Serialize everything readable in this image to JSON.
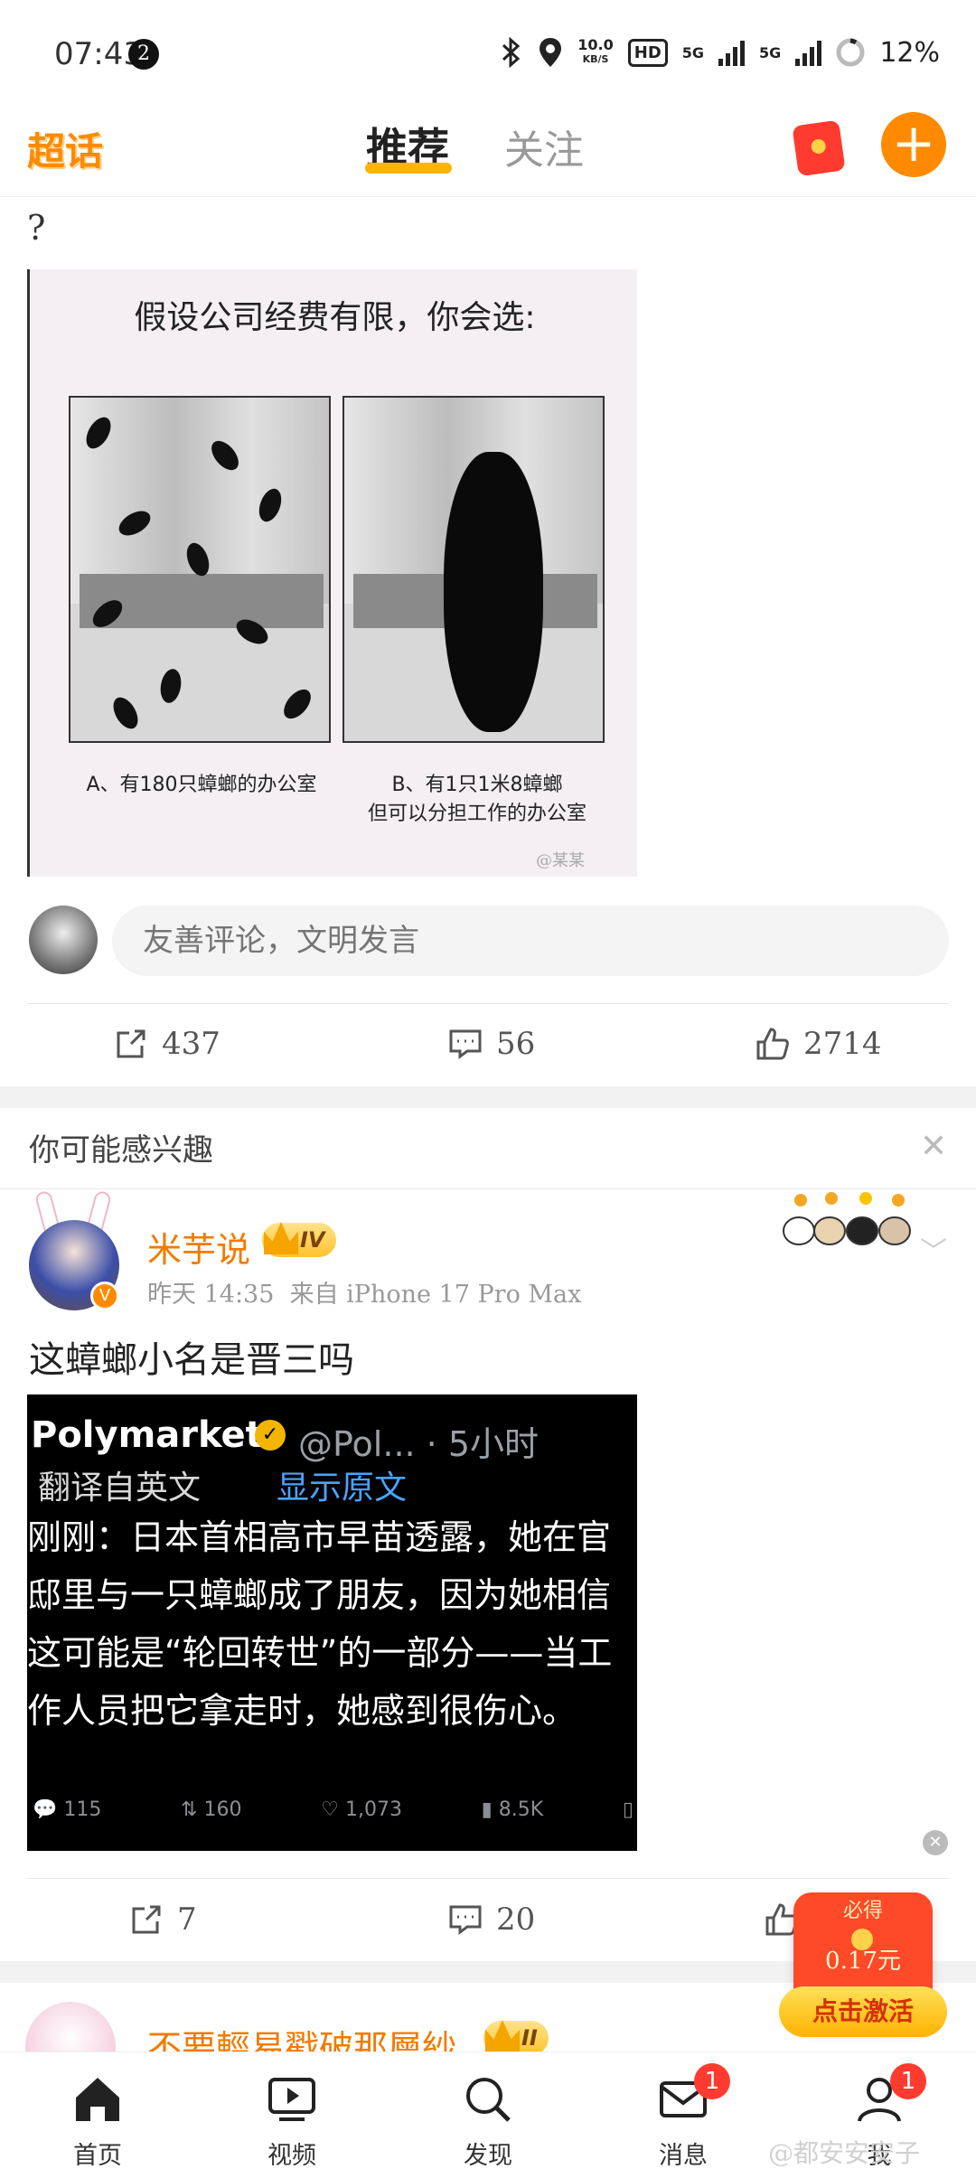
{
  "status_bar": {
    "time": "07:43",
    "notification_count": "2",
    "network_speed_top": "10.0",
    "network_speed_bottom": "KB/S",
    "hd_label": "HD",
    "sim1_label": "5G",
    "sim2_label": "5G",
    "battery": "12%"
  },
  "top_nav": {
    "logo": "超话",
    "tabs": [
      {
        "label": "推荐",
        "active": true
      },
      {
        "label": "关注",
        "active": false
      }
    ],
    "accent_color": "#ff8a00"
  },
  "post1": {
    "text": "?",
    "image": {
      "title": "假设公司经费有限，你会选:",
      "caption_a": "A、有180只蟑螂的办公室",
      "caption_b_line1": "B、有1只1米8蟑螂",
      "caption_b_line2": "但可以分担工作的办公室",
      "watermark": "@某某"
    },
    "comment_placeholder": "友善评论，文明发言",
    "actions": {
      "share": "437",
      "comment": "56",
      "like": "2714"
    }
  },
  "recommendations": {
    "header": "你可能感兴趣",
    "close_icon": "close-icon"
  },
  "post2": {
    "username": "米芋说",
    "level": "IV",
    "time": "昨天 14:35",
    "source": "来自 iPhone 17 Pro Max",
    "text": "这蟑螂小名是晋三吗",
    "tweet": {
      "author": "Polymarket",
      "handle": "@Pol... · 5小时",
      "translate_label": "翻译自英文",
      "show_original": "显示原文",
      "body": "刚刚：日本首相高市早苗透露，她在官邸里与一只蟑螂成了朋友，因为她相信这可能是“轮回转世”的一部分——当工作人员把它拿走时，她感到很伤心。",
      "replies": "115",
      "retweets": "160",
      "likes": "1,073",
      "views": "8.5K"
    },
    "actions": {
      "share": "7",
      "comment": "20"
    }
  },
  "post3": {
    "username": "不要輕易戳破那層紗",
    "level": "II"
  },
  "reward_widget": {
    "must_get": "必得",
    "amount": "0.17元",
    "activate": "点击激活"
  },
  "bottom_nav": [
    {
      "label": "首页",
      "icon": "home-icon",
      "active": true
    },
    {
      "label": "视频",
      "icon": "video-icon"
    },
    {
      "label": "发现",
      "icon": "search-icon"
    },
    {
      "label": "消息",
      "icon": "mail-icon",
      "badge": "1"
    },
    {
      "label": "我",
      "icon": "profile-icon",
      "badge": "1"
    }
  ],
  "screen_watermark": "@都安安安子"
}
